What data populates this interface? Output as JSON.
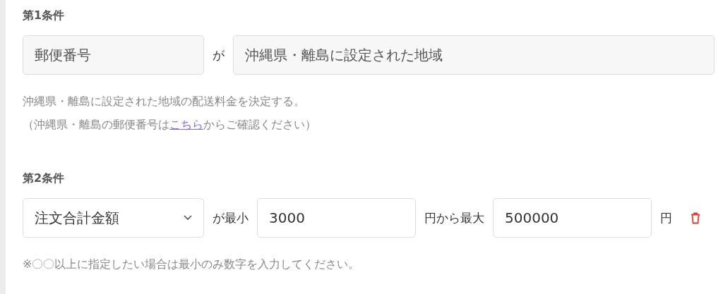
{
  "conditions": [
    {
      "heading": "第1条件",
      "row": [
        {
          "kind": "field",
          "value": "郵便番号",
          "disabled": true
        },
        {
          "kind": "label",
          "text": "が"
        },
        {
          "kind": "field",
          "value": "沖縄県・離島に設定された地域",
          "disabled": true
        }
      ],
      "notes": [
        {
          "text": "沖縄県・離島に設定された地域の配送料金を決定する。"
        },
        {
          "text": "（沖縄県・離島の郵便番号は",
          "link": "こちら",
          "after": "からご確認ください）"
        }
      ]
    },
    {
      "heading": "第2条件",
      "row": [
        {
          "kind": "select",
          "value": "注文合計金額"
        },
        {
          "kind": "label",
          "text": "が最小"
        },
        {
          "kind": "field",
          "value": "3000",
          "disabled": false
        },
        {
          "kind": "label",
          "text": "円から最大"
        },
        {
          "kind": "field",
          "value": "500000",
          "disabled": false
        },
        {
          "kind": "label",
          "text": "円"
        },
        {
          "kind": "delete"
        }
      ],
      "notes": [
        {
          "text": "※〇〇以上に指定したい場合は最小のみ数字を入力してください。"
        }
      ]
    }
  ]
}
